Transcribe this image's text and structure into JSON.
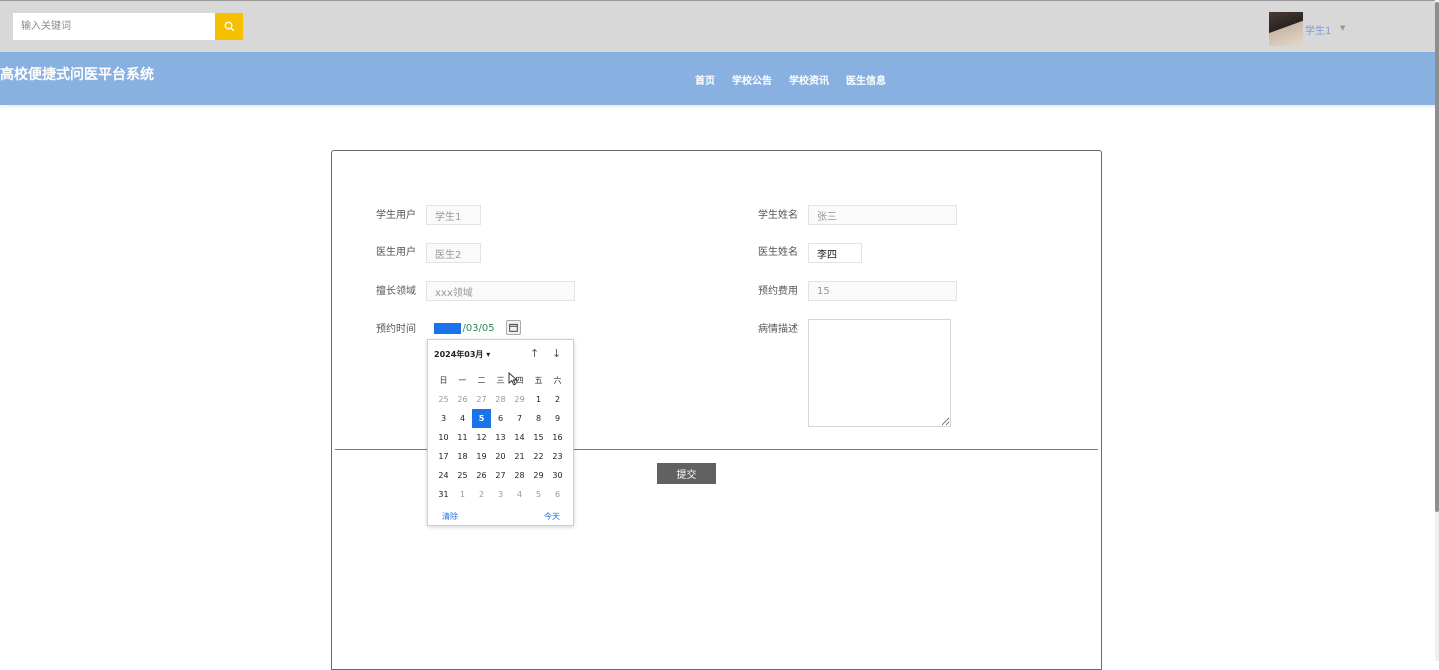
{
  "topbar": {
    "search_placeholder": "输入关键词",
    "username": "学生1",
    "icons": {
      "search": "search-icon",
      "caret": "caret-down-icon"
    }
  },
  "header": {
    "site_title": "高校便捷式问医平台系统",
    "nav": [
      "首页",
      "学校公告",
      "学校资讯",
      "医生信息"
    ]
  },
  "form": {
    "student_account_label": "学生用户",
    "student_account_value": "学生1",
    "student_name_label": "学生姓名",
    "student_name_value": "张三",
    "doctor_account_label": "医生用户",
    "doctor_account_value": "医生2",
    "doctor_name_label": "医生姓名",
    "doctor_name_value": "李四",
    "field_label": "擅长领域",
    "field_value": "xxx领域",
    "fee_label": "预约费用",
    "fee_value": "15",
    "time_label": "预约时间",
    "date_year": "2024",
    "date_rest": "/03/05",
    "desc_label": "病情描述",
    "desc_value": "",
    "submit_label": "提交"
  },
  "calendar": {
    "month_label": "2024年03月",
    "weekdays": [
      "日",
      "一",
      "二",
      "三",
      "四",
      "五",
      "六"
    ],
    "weeks": [
      [
        "25",
        "26",
        "27",
        "28",
        "29",
        "1",
        "2"
      ],
      [
        "3",
        "4",
        "5",
        "6",
        "7",
        "8",
        "9"
      ],
      [
        "10",
        "11",
        "12",
        "13",
        "14",
        "15",
        "16"
      ],
      [
        "17",
        "18",
        "19",
        "20",
        "21",
        "22",
        "23"
      ],
      [
        "24",
        "25",
        "26",
        "27",
        "28",
        "29",
        "30"
      ],
      [
        "31",
        "1",
        "2",
        "3",
        "4",
        "5",
        "6"
      ]
    ],
    "selected_day": "5",
    "clear_label": "清除",
    "today_label": "今天"
  },
  "colors": {
    "topbar_bg": "#d8d8d8",
    "navbar_bg": "#88b0e0",
    "search_button": "#f6c000",
    "accent": "#1a73e8",
    "submit_bg": "#616161"
  }
}
